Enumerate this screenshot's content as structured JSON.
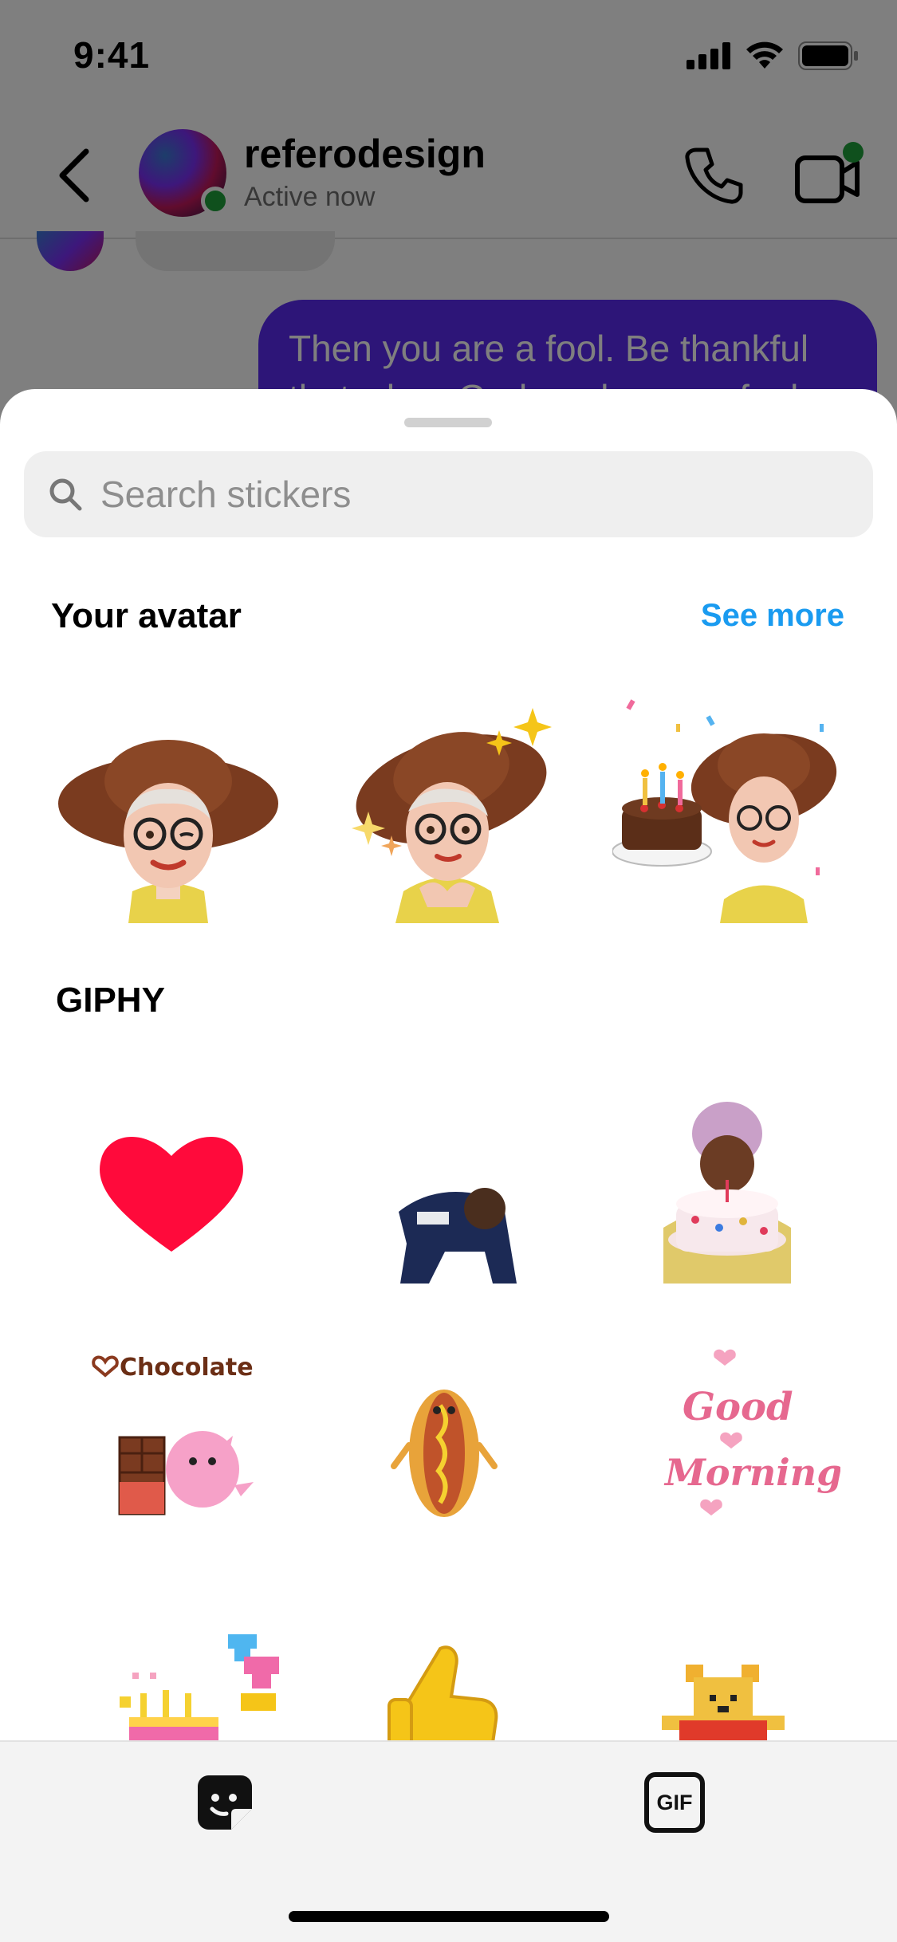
{
  "status_bar": {
    "time": "9:41"
  },
  "chat": {
    "contact_name": "referodesign",
    "contact_status": "Active now",
    "outgoing_message": "Then you are a fool. Be thankful that when God made you a fool"
  },
  "sticker_sheet": {
    "search_placeholder": "Search stickers",
    "avatar_section": {
      "title": "Your avatar",
      "see_more_label": "See more",
      "stickers": [
        "avatar-winking",
        "avatar-sparkles",
        "avatar-birthday-cake"
      ]
    },
    "giphy_section": {
      "title": "GIPHY",
      "stickers": [
        "heart",
        "football-player",
        "woman-with-cake",
        "chocolate-dino",
        "hot-dog",
        "good-morning",
        "pixel-birthday-cake",
        "thumbs-up",
        "winnie-the-pooh"
      ]
    },
    "chocolate_label": "Chocolate",
    "good_morning_label_1": "Good",
    "good_morning_label_2": "Morning!"
  },
  "tab_bar": {
    "tabs": [
      {
        "name": "stickers",
        "icon": "sticker-icon",
        "active": true
      },
      {
        "name": "gif",
        "label": "GIF",
        "icon": "gif-icon",
        "active": false
      }
    ]
  },
  "colors": {
    "accent_link": "#1a9bf0",
    "outgoing_bubble": "#5a2bf0",
    "online_dot": "#1fa03a",
    "heart_red": "#ff0a3b"
  }
}
